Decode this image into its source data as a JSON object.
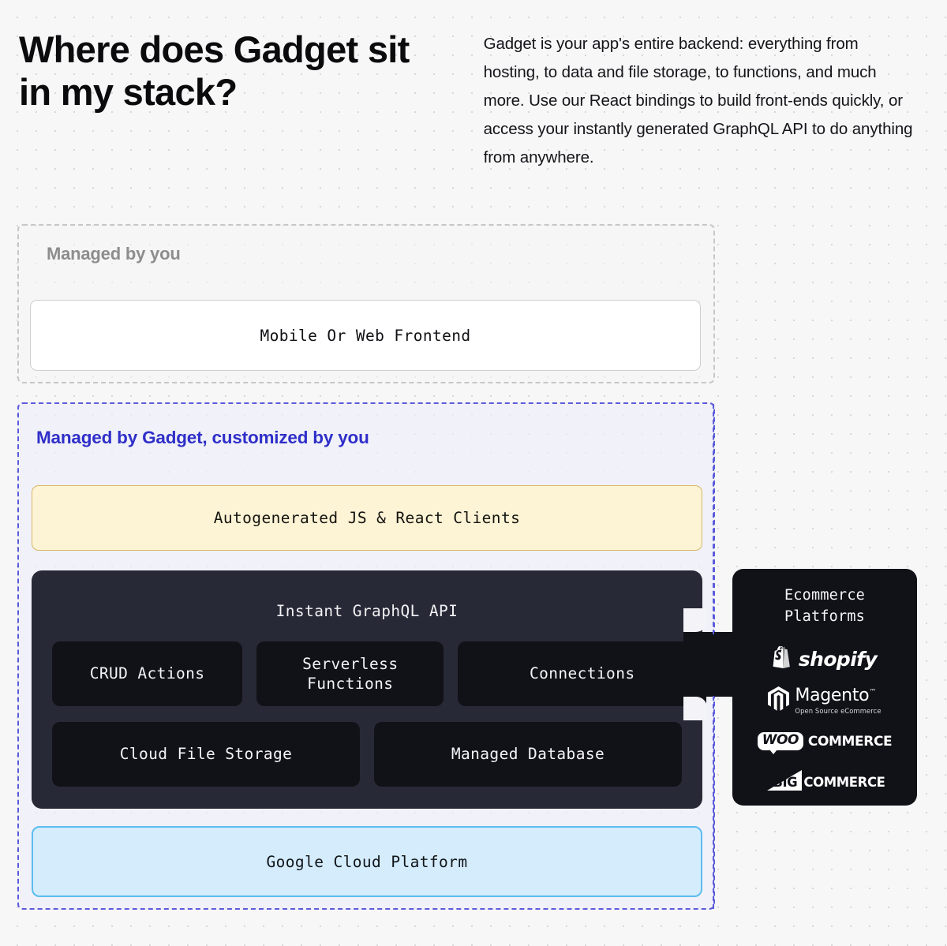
{
  "header": {
    "headline": "Where does Gadget sit in my stack?",
    "intro": "Gadget is your app's entire backend: everything from hosting, to data and file storage, to functions, and much more. Use our React bindings to build front-ends quickly, or access your instantly generated GraphQL API to do anything from anywhere."
  },
  "zones": {
    "managed_by_you": {
      "label": "Managed by you",
      "frontend_card": "Mobile Or Web Frontend"
    },
    "managed_by_gadget": {
      "label": "Managed by Gadget, customized by you",
      "clients_card": "Autogenerated JS & React Clients",
      "api_panel": {
        "title": "Instant GraphQL API",
        "boxes": [
          {
            "label": "CRUD Actions"
          },
          {
            "label": "Serverless\nFunctions"
          },
          {
            "label": "Connections"
          },
          {
            "label": "Cloud File Storage"
          },
          {
            "label": "Managed Database"
          }
        ]
      },
      "gcp_card": "Google Cloud Platform"
    }
  },
  "ecommerce_panel": {
    "title": "Ecommerce Platforms",
    "title_line1": "Ecommerce",
    "title_line2": "Platforms",
    "logos": [
      {
        "name": "shopify",
        "word": "shopify"
      },
      {
        "name": "magento",
        "word": "Magento",
        "trademark": "™",
        "tagline": "Open Source eCommerce"
      },
      {
        "name": "woocommerce",
        "badge": "WOO",
        "word": "COMMERCE"
      },
      {
        "name": "bigcommerce",
        "mark_text": "BIG",
        "word": "COMMERCE"
      }
    ]
  },
  "colors": {
    "background": "#f7f7f7",
    "dot_grid": "#d8d8d8",
    "gadget_blue": "#2f2fc9",
    "gadget_dashed_border": "#5b5bdb",
    "you_label_gray": "#8d8d8d",
    "you_dashed_border": "#c7c7c7",
    "clients_fill": "#fdf3d5",
    "clients_border": "#d9b866",
    "panel_fill": "#272936",
    "box_fill": "#111118",
    "gcp_fill": "#d4ecfb",
    "gcp_border": "#5cbcf0"
  }
}
